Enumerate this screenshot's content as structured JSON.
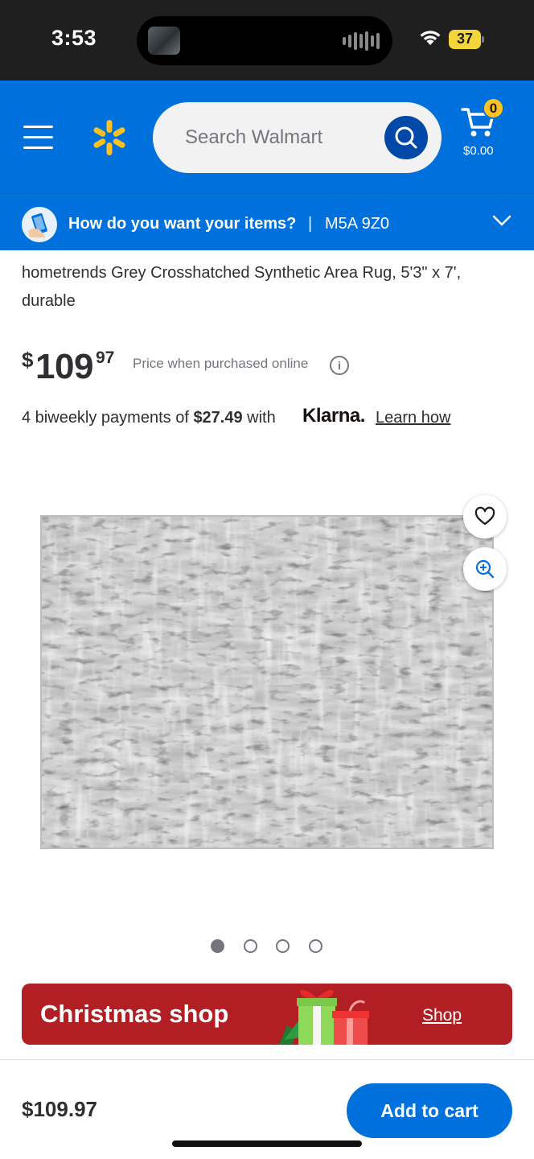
{
  "status_bar": {
    "time": "3:53",
    "battery": "37"
  },
  "header": {
    "menu_icon": "hamburger-menu-icon",
    "logo_icon": "walmart-spark-icon",
    "search_placeholder": "Search Walmart",
    "search_icon": "search-icon",
    "cart_icon": "cart-icon",
    "cart_count": "0",
    "cart_total": "$0.00"
  },
  "delivery": {
    "question": "How do you want your items?",
    "separator": "|",
    "postal_code": "M5A 9Z0",
    "chevron_icon": "chevron-down-icon"
  },
  "product": {
    "title": "hometrends Grey Crosshatched Synthetic Area Rug, 5'3\" x 7', durable",
    "price_currency": "$",
    "price_dollars": "109",
    "price_cents": "97",
    "price_note": "Price when purchased online",
    "info_icon": "info-icon",
    "installment_prefix": "4 biweekly payments of ",
    "installment_amount": "$27.49",
    "installment_suffix": " with",
    "klarna_logo": "Klarna.",
    "learn_how": "Learn how",
    "favorite_icon": "heart-icon",
    "zoom_icon": "zoom-in-icon",
    "image_count": 4,
    "active_image": 1
  },
  "promo": {
    "title": "Christmas shop",
    "link": "Shop",
    "background": "#b11f24"
  },
  "bottom_bar": {
    "price": "$109.97",
    "add_to_cart": "Add to cart"
  },
  "colors": {
    "brand_blue": "#0071dc",
    "spark_yellow": "#ffc220",
    "search_button": "#0049a8"
  }
}
